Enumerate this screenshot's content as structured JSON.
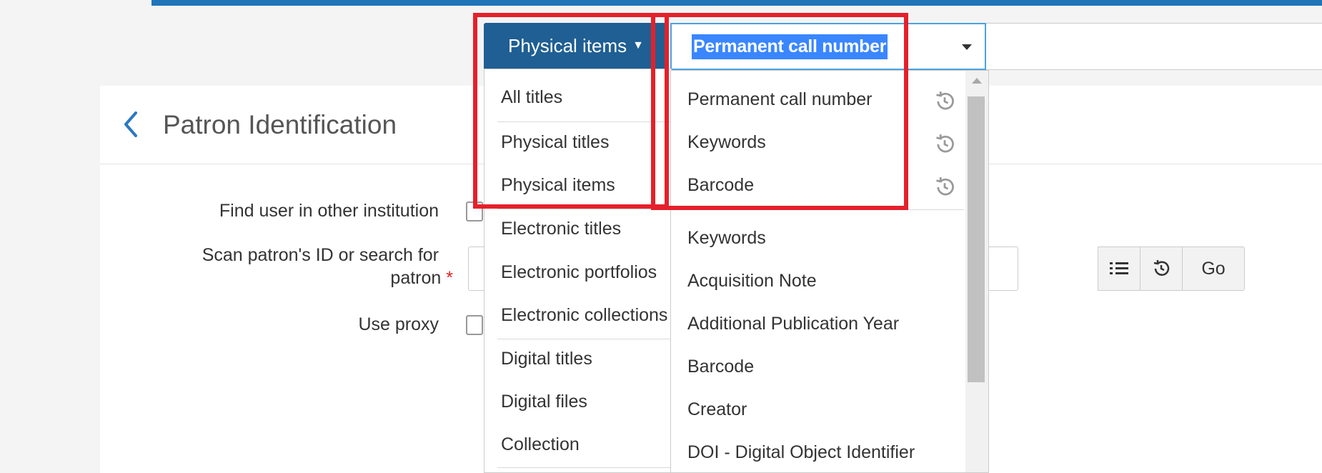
{
  "search": {
    "scope_label": "Physical items",
    "scope_caret": "▼",
    "field_selected": "Permanent call number"
  },
  "scope_menu": {
    "items": [
      "All titles",
      "Physical titles",
      "Physical items",
      "Electronic titles",
      "Electronic portfolios",
      "Electronic collections",
      "Digital titles",
      "Digital files",
      "Collection"
    ]
  },
  "field_menu": {
    "recent": [
      "Permanent call number",
      "Keywords",
      "Barcode"
    ],
    "all": [
      "Keywords",
      "Acquisition Note",
      "Additional Publication Year",
      "Barcode",
      "Creator",
      "DOI - Digital Object Identifier"
    ],
    "recent_icon": "history-icon"
  },
  "page": {
    "title": "Patron Identification",
    "back_icon": "chevron-left-icon"
  },
  "form": {
    "find_other_institution_label": "Find user in other institution",
    "scan_patron_label_line1": "Scan patron's ID or search for",
    "scan_patron_label_line2": "patron",
    "required_mark": "*",
    "use_proxy_label": "Use proxy",
    "go_label": "Go"
  },
  "colors": {
    "primary_blue": "#1f5f93",
    "highlight_red": "#e5202a",
    "selection_blue": "#3a86ff"
  }
}
